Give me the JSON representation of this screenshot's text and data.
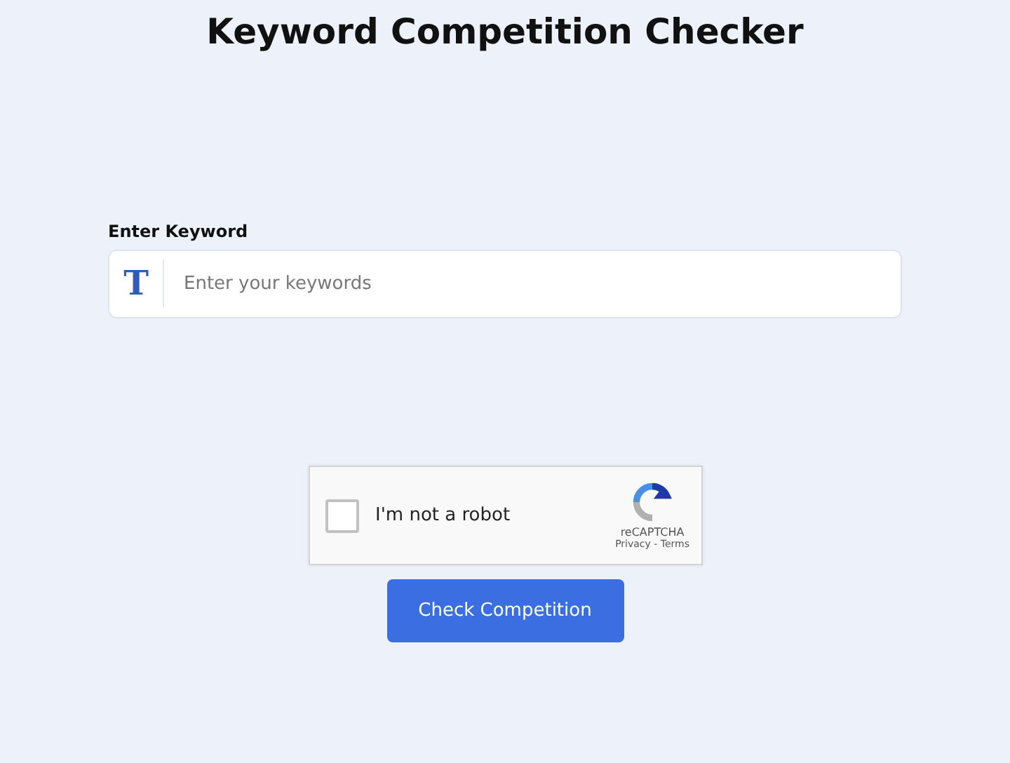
{
  "title": "Keyword Competition Checker",
  "keyword_field": {
    "label": "Enter Keyword",
    "icon_glyph": "T",
    "placeholder": "Enter your keywords"
  },
  "captcha": {
    "label": "I'm not a robot",
    "checked": false,
    "brand": "reCAPTCHA",
    "links": "Privacy - Terms"
  },
  "submit_button": "Check Competition"
}
